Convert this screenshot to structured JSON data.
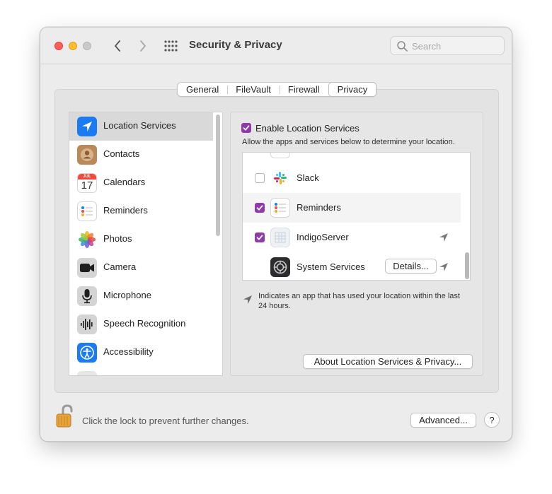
{
  "window": {
    "title": "Security & Privacy",
    "search_placeholder": "Search"
  },
  "tabs": [
    {
      "label": "General"
    },
    {
      "label": "FileVault"
    },
    {
      "label": "Firewall"
    },
    {
      "label": "Privacy",
      "active": true
    }
  ],
  "sidebar": {
    "items": [
      {
        "label": "Location Services",
        "icon": "location-arrow-icon",
        "selected": true
      },
      {
        "label": "Contacts",
        "icon": "contacts-icon"
      },
      {
        "label": "Calendars",
        "icon": "calendar-icon",
        "month": "JUL",
        "day": "17"
      },
      {
        "label": "Reminders",
        "icon": "reminders-icon"
      },
      {
        "label": "Photos",
        "icon": "photos-icon"
      },
      {
        "label": "Camera",
        "icon": "camera-icon"
      },
      {
        "label": "Microphone",
        "icon": "microphone-icon"
      },
      {
        "label": "Speech Recognition",
        "icon": "speech-waveform-icon"
      },
      {
        "label": "Accessibility",
        "icon": "accessibility-icon"
      }
    ]
  },
  "location": {
    "enable_label": "Enable Location Services",
    "enabled": true,
    "description": "Allow the apps and services below to determine your location.",
    "apps": [
      {
        "name": "Slack",
        "checked": false,
        "icon": "slack-icon",
        "recent": false
      },
      {
        "name": "Reminders",
        "checked": true,
        "icon": "reminders-icon",
        "recent": false
      },
      {
        "name": "IndigoServer",
        "checked": true,
        "icon": "indigo-server-icon",
        "recent": true
      },
      {
        "name": "System Services",
        "icon": "gear-icon",
        "recent": true,
        "details_label": "Details..."
      }
    ],
    "note": "Indicates an app that has used your location within the last 24 hours.",
    "about_button": "About Location Services & Privacy..."
  },
  "footer": {
    "lock_text": "Click the lock to prevent further changes.",
    "advanced_button": "Advanced...",
    "help_button": "?"
  },
  "colors": {
    "checkbox_accent": "#8e3aa8",
    "location_blue": "#1a7bf2",
    "window_bg": "#ececec"
  }
}
